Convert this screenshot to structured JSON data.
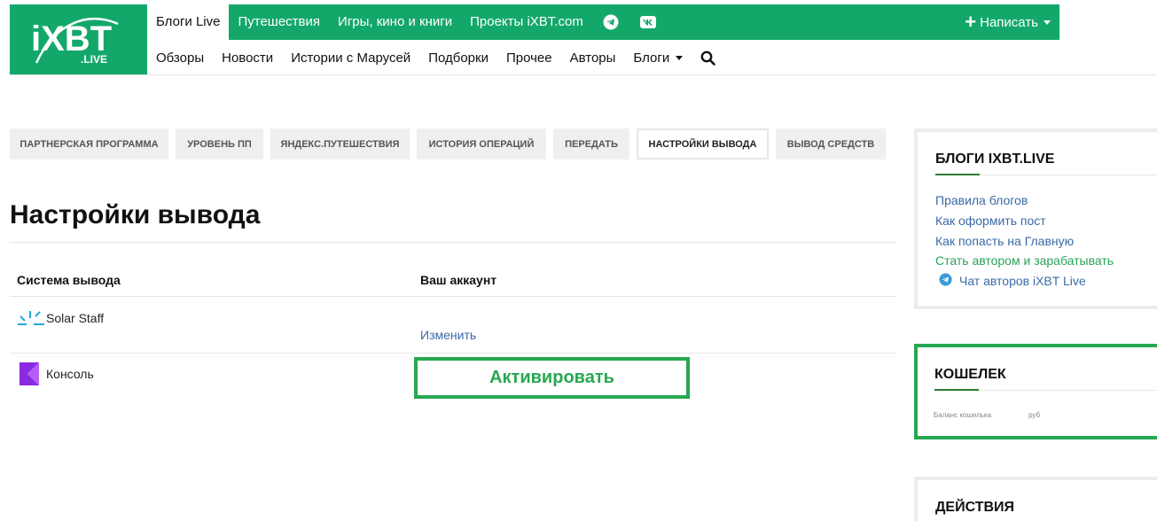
{
  "logo": {
    "brand": "iXBT",
    "sub": ".LIVE"
  },
  "topnav": {
    "items": [
      {
        "label": "Блоги Live",
        "active": true
      },
      {
        "label": "Путешествия"
      },
      {
        "label": "Игры, кино и книги"
      },
      {
        "label": "Проекты iXBT.com"
      }
    ],
    "icons": [
      "telegram-icon",
      "vk-icon"
    ],
    "write_label": "Написать",
    "accent": "#13a86a"
  },
  "subnav": {
    "items": [
      "Обзоры",
      "Новости",
      "Истории с Марусей",
      "Подборки",
      "Прочее",
      "Авторы"
    ],
    "dropdown_label": "Блоги"
  },
  "tabs": [
    {
      "label": "Партнерская программа"
    },
    {
      "label": "Уровень ПП"
    },
    {
      "label": "Яндекс.Путешествия"
    },
    {
      "label": "История операций"
    },
    {
      "label": "Передать"
    },
    {
      "label": "Настройки вывода",
      "active": true
    },
    {
      "label": "Вывод средств"
    }
  ],
  "page": {
    "title": "Настройки вывода",
    "col_system": "Система вывода",
    "col_account": "Ваш аккаунт",
    "rows": [
      {
        "system": "Solar Staff",
        "icon": "solar-staff-icon",
        "action": "Изменить"
      },
      {
        "system": "Консоль",
        "icon": "konsol-icon",
        "action": "Активировать"
      }
    ]
  },
  "sidebar": {
    "blogs": {
      "title": "Блоги iXBT.live",
      "links": [
        {
          "label": "Правила блогов"
        },
        {
          "label": "Как оформить пост"
        },
        {
          "label": "Как попасть на Главную"
        },
        {
          "label": "Стать автором и зарабатывать",
          "color": "green"
        },
        {
          "label": "Чат авторов iXBT Live",
          "icon": "telegram-icon"
        }
      ]
    },
    "wallet": {
      "title": "Кошелек",
      "balance_label": "Баланс кошелька",
      "balance_unit": "руб"
    },
    "actions": {
      "title": "Действия"
    }
  },
  "colors": {
    "green": "#13a86a",
    "highlight": "#26a851",
    "link": "#3a6aa8"
  }
}
